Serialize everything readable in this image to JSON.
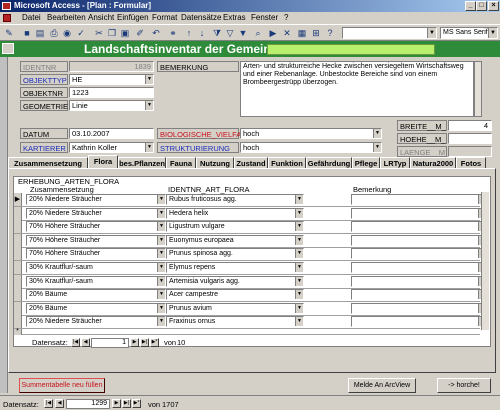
{
  "window": {
    "title": "Microsoft Access - [Plan : Formular]",
    "min": "_",
    "max": "□",
    "close": "×"
  },
  "menu": [
    "Datei",
    "Bearbeiten",
    "Ansicht",
    "Einfügen",
    "Format",
    "Datensätze",
    "Extras",
    "Fenster",
    "?"
  ],
  "toolbar": {
    "font": "MS Sans Serif"
  },
  "header": {
    "title": "Landschaftsinventar der Gemeinde"
  },
  "fields": {
    "identnr": {
      "label": "IDENTNR",
      "value": "1839"
    },
    "objekttyp": {
      "label": "OBJEKTTYP",
      "value": "HE"
    },
    "objektnr": {
      "label": "OBJEKTNR",
      "value": "1223"
    },
    "geometrie": {
      "label": "GEOMETRIE",
      "value": "Linie"
    },
    "bemerkung": {
      "label": "BEMERKUNG",
      "value": "Arten- und strukturreiche Hecke zwischen versiegeltem Wirtschaftsweg und einer Rebenanlage. Unbestockte Bereiche sind von einem Brombeergestrüpp überzogen."
    },
    "datum": {
      "label": "DATUM",
      "value": "03.10.2007"
    },
    "kartierer": {
      "label": "KARTIERER",
      "value": "Kathrin Koller"
    },
    "biologische_vielfalt": {
      "label": "BIOLOGISCHE_VIELFALT",
      "value": "hoch"
    },
    "strukturierung": {
      "label": "STRUKTURIERUNG",
      "value": "hoch"
    },
    "breite": {
      "label": "BREITE__M_",
      "value": "4"
    },
    "hoehe": {
      "label": "HOEHE__M_",
      "value": ""
    },
    "laenge": {
      "label": "LAENGE__M_",
      "value": ""
    }
  },
  "tabs": [
    "Zusammensetzung",
    "Flora",
    "bes.Pflanzen",
    "Fauna",
    "Nutzung",
    "Zustand",
    "Funktion",
    "Gefährdung",
    "Pflege",
    "LRTyp",
    "Natura2000",
    "Fotos"
  ],
  "active_tab": "Flora",
  "subform": {
    "title": "ERHEBUNG_ARTEN_FLORA",
    "columns": [
      "Zusammensetzung",
      "IDENTNR_ART_FLORA",
      "Bemerkung"
    ],
    "rows": [
      {
        "zus": "20% Niedere Sträucher",
        "art": "Rubus fruticosus agg.",
        "bem": ""
      },
      {
        "zus": "20% Niedere Sträucher",
        "art": "Hedera helix",
        "bem": ""
      },
      {
        "zus": "70% Höhere Sträucher",
        "art": "Ligustrum vulgare",
        "bem": ""
      },
      {
        "zus": "70% Höhere Sträucher",
        "art": "Euonymus europaea",
        "bem": ""
      },
      {
        "zus": "70% Höhere Sträucher",
        "art": "Prunus spinosa agg.",
        "bem": ""
      },
      {
        "zus": "30% Krautflur/-saum",
        "art": "Elymus repens",
        "bem": ""
      },
      {
        "zus": "30% Krautflur/-saum",
        "art": "Artemisia vulgaris agg.",
        "bem": ""
      },
      {
        "zus": "20% Bäume",
        "art": "Acer campestre",
        "bem": ""
      },
      {
        "zus": "20% Bäume",
        "art": "Prunus avium",
        "bem": ""
      },
      {
        "zus": "20% Niedere Sträucher",
        "art": "Fraxinus ornus",
        "bem": ""
      }
    ],
    "new_row_marker": "*",
    "current_row_marker": "▶",
    "nav": {
      "label": "Datensatz:",
      "current": "1",
      "of_label": "von",
      "total": "10"
    }
  },
  "buttons": {
    "summary": "Summentabelle neu füllen",
    "arcview": "Melde An ArcView",
    "horche": "-> horche!"
  },
  "recordnav": {
    "label": "Datensatz:",
    "current": "1299",
    "of_label": "von",
    "total": "1707"
  }
}
